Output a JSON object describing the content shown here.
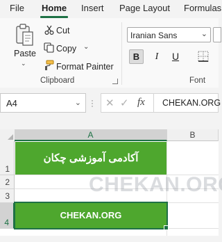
{
  "ribbon_tabs": [
    "File",
    "Home",
    "Insert",
    "Page Layout",
    "Formulas"
  ],
  "active_tab": "Home",
  "clipboard": {
    "paste_label": "Paste",
    "cut_label": "Cut",
    "copy_label": "Copy",
    "format_painter_label": "Format Painter",
    "group_label": "Clipboard"
  },
  "font": {
    "font_name": "Iranian Sans",
    "bold_label": "B",
    "italic_label": "I",
    "underline_label": "U",
    "group_label": "Font"
  },
  "formula_bar": {
    "name_box": "A4",
    "fx_label": "fx",
    "formula_value": "CHEKAN.ORG"
  },
  "columns": [
    "A",
    "B"
  ],
  "rows": [
    "1",
    "2",
    "3",
    "4"
  ],
  "cells": {
    "A1": "آکادمی آموزشی چکان",
    "A4": "CHEKAN.ORG"
  },
  "colors": {
    "cell_fill": "#4ea72e",
    "accent": "#1e7145"
  },
  "watermark": "CHEKAN.ORG"
}
